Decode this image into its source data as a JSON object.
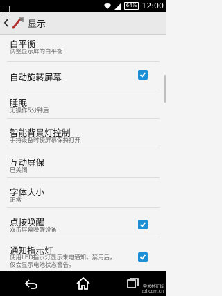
{
  "status_bar": {
    "battery": "64%",
    "time": "12:00"
  },
  "action_bar": {
    "title": "显示"
  },
  "settings": {
    "white_balance": {
      "title": "白平衡",
      "summary": "调整显示屏的白平衡"
    },
    "auto_rotate": {
      "title": "自动旋转屏幕",
      "checked": true
    },
    "sleep": {
      "title": "睡眠",
      "summary": "无操作5分钟后"
    },
    "smart_backlight": {
      "title": "智能背景灯控制",
      "summary": "手持设备时使屏幕保持打开"
    },
    "daydream": {
      "title": "互动屏保",
      "summary": "已关闭"
    },
    "font_size": {
      "title": "字体大小",
      "summary": "正常"
    },
    "tap_to_wake": {
      "title": "点按唤醒",
      "summary": "双击屏幕唤醒设备",
      "checked": true
    },
    "notification_light": {
      "title": "通知指示灯",
      "summary_line1": "使用LED指示灯显示来电通知。禁用后，",
      "summary_line2": "仅会显示电池状态警告。",
      "checked": true
    }
  },
  "watermark": {
    "line1": "中关村在线",
    "line2": "zol.com.cn"
  },
  "colors": {
    "checkbox": "#1d8fd6",
    "action_bar": "#e9e9e9",
    "background": "#f4f4f4"
  },
  "icons": [
    "back-chevron-icon",
    "display-settings-icon",
    "wifi-icon",
    "signal-icon",
    "battery-icon",
    "nav-back-icon",
    "nav-home-icon",
    "nav-recents-icon"
  ]
}
